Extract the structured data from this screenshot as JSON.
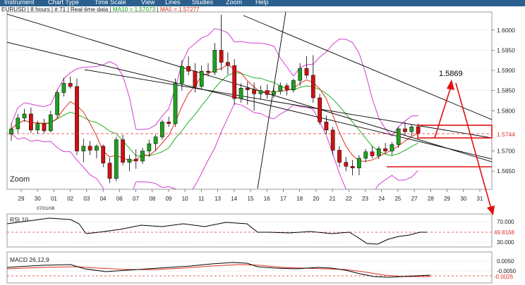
{
  "menu": [
    "Instrument",
    "Chart Type",
    "Time Scale",
    "View",
    "Lines",
    "Studies",
    "Zoom",
    "Help"
  ],
  "header": {
    "symbol": "EURUSD",
    "interval": "8 hours",
    "bars": "# 71",
    "feed": "Real-time data",
    "ma_label": "MA10 = 1.57073",
    "ma2_label": "MA5 = 1.57277"
  },
  "zoom_label": "Zoom",
  "annotation_value": "1.5869",
  "price_axis": {
    "ticks": [
      "1.6000",
      "1.5950",
      "1.5900",
      "1.5850",
      "1.5800",
      "1.5700",
      "1.5650"
    ],
    "current": "1.5744"
  },
  "date_axis": {
    "labels": [
      "29",
      "30",
      "01",
      "02",
      "03",
      "04",
      "06",
      "07",
      "08",
      "09",
      "10",
      "11",
      "13",
      "14",
      "15",
      "16",
      "17",
      "18",
      "20",
      "21",
      "22",
      "23",
      "24",
      "25",
      "27",
      "28",
      "29",
      "30",
      "31"
    ],
    "month_label": "07/01/08"
  },
  "rsi": {
    "label": "RSI 10",
    "ticks": [
      "70.000",
      "30.000"
    ],
    "current": "49.8168"
  },
  "macd": {
    "label": "MACD 26,12,9",
    "ticks": [
      "0.0050",
      "-0.0050"
    ],
    "current": "-0.0026"
  },
  "colors": {
    "menubar": "#2a5f8e",
    "bull": "#1fa01f",
    "bear": "#d01010",
    "bollinger": "#d040d0",
    "ma_green": "#20b020",
    "ma_red": "#e03020",
    "annotation": "#e01010",
    "price_marker": "#e03030"
  },
  "chart_data": {
    "type": "candlestick",
    "title": "EURUSD",
    "y_range": [
      1.5605,
      1.6045
    ],
    "candles": [
      {
        "o": 1.5742,
        "h": 1.5768,
        "l": 1.5725,
        "c": 1.5755
      },
      {
        "o": 1.5755,
        "h": 1.5792,
        "l": 1.5745,
        "c": 1.5782
      },
      {
        "o": 1.5782,
        "h": 1.5805,
        "l": 1.5772,
        "c": 1.5792
      },
      {
        "o": 1.5792,
        "h": 1.5808,
        "l": 1.5745,
        "c": 1.5752
      },
      {
        "o": 1.5752,
        "h": 1.5775,
        "l": 1.5742,
        "c": 1.5768
      },
      {
        "o": 1.5768,
        "h": 1.578,
        "l": 1.5744,
        "c": 1.575
      },
      {
        "o": 1.575,
        "h": 1.58,
        "l": 1.5746,
        "c": 1.579
      },
      {
        "o": 1.579,
        "h": 1.5852,
        "l": 1.5782,
        "c": 1.5845
      },
      {
        "o": 1.5845,
        "h": 1.5882,
        "l": 1.5835,
        "c": 1.5868
      },
      {
        "o": 1.5868,
        "h": 1.5885,
        "l": 1.5855,
        "c": 1.586
      },
      {
        "o": 1.586,
        "h": 1.588,
        "l": 1.569,
        "c": 1.57
      },
      {
        "o": 1.57,
        "h": 1.573,
        "l": 1.5672,
        "c": 1.5712
      },
      {
        "o": 1.5712,
        "h": 1.5725,
        "l": 1.569,
        "c": 1.5702
      },
      {
        "o": 1.5702,
        "h": 1.5716,
        "l": 1.5682,
        "c": 1.5712
      },
      {
        "o": 1.5712,
        "h": 1.5716,
        "l": 1.566,
        "c": 1.567
      },
      {
        "o": 1.567,
        "h": 1.5684,
        "l": 1.562,
        "c": 1.5632
      },
      {
        "o": 1.5632,
        "h": 1.5735,
        "l": 1.5625,
        "c": 1.5728
      },
      {
        "o": 1.5728,
        "h": 1.574,
        "l": 1.5665,
        "c": 1.5672
      },
      {
        "o": 1.5672,
        "h": 1.569,
        "l": 1.565,
        "c": 1.568
      },
      {
        "o": 1.568,
        "h": 1.5704,
        "l": 1.5656,
        "c": 1.5675
      },
      {
        "o": 1.5675,
        "h": 1.5708,
        "l": 1.5668,
        "c": 1.57
      },
      {
        "o": 1.57,
        "h": 1.5728,
        "l": 1.5685,
        "c": 1.5718
      },
      {
        "o": 1.5718,
        "h": 1.574,
        "l": 1.57,
        "c": 1.5735
      },
      {
        "o": 1.5735,
        "h": 1.5778,
        "l": 1.5728,
        "c": 1.5772
      },
      {
        "o": 1.5772,
        "h": 1.5785,
        "l": 1.576,
        "c": 1.5768
      },
      {
        "o": 1.5768,
        "h": 1.588,
        "l": 1.576,
        "c": 1.5868
      },
      {
        "o": 1.5868,
        "h": 1.5925,
        "l": 1.585,
        "c": 1.591
      },
      {
        "o": 1.591,
        "h": 1.5935,
        "l": 1.5888,
        "c": 1.5898
      },
      {
        "o": 1.5898,
        "h": 1.5918,
        "l": 1.5845,
        "c": 1.586
      },
      {
        "o": 1.586,
        "h": 1.5912,
        "l": 1.5852,
        "c": 1.5898
      },
      {
        "o": 1.5898,
        "h": 1.5918,
        "l": 1.5885,
        "c": 1.5895
      },
      {
        "o": 1.5895,
        "h": 1.5968,
        "l": 1.5888,
        "c": 1.595
      },
      {
        "o": 1.595,
        "h": 1.6038,
        "l": 1.59,
        "c": 1.592
      },
      {
        "o": 1.592,
        "h": 1.5945,
        "l": 1.589,
        "c": 1.5912
      },
      {
        "o": 1.5912,
        "h": 1.5928,
        "l": 1.5815,
        "c": 1.583
      },
      {
        "o": 1.583,
        "h": 1.5868,
        "l": 1.582,
        "c": 1.5856
      },
      {
        "o": 1.5856,
        "h": 1.5872,
        "l": 1.5815,
        "c": 1.5852
      },
      {
        "o": 1.5852,
        "h": 1.587,
        "l": 1.58,
        "c": 1.5842
      },
      {
        "o": 1.5842,
        "h": 1.5862,
        "l": 1.5828,
        "c": 1.585
      },
      {
        "o": 1.585,
        "h": 1.5865,
        "l": 1.583,
        "c": 1.584
      },
      {
        "o": 1.584,
        "h": 1.5862,
        "l": 1.5832,
        "c": 1.5848
      },
      {
        "o": 1.5848,
        "h": 1.587,
        "l": 1.584,
        "c": 1.5862
      },
      {
        "o": 1.5862,
        "h": 1.5868,
        "l": 1.5838,
        "c": 1.5852
      },
      {
        "o": 1.5852,
        "h": 1.588,
        "l": 1.5845,
        "c": 1.5875
      },
      {
        "o": 1.5875,
        "h": 1.5918,
        "l": 1.5862,
        "c": 1.5905
      },
      {
        "o": 1.5905,
        "h": 1.5935,
        "l": 1.588,
        "c": 1.5888
      },
      {
        "o": 1.5888,
        "h": 1.5938,
        "l": 1.582,
        "c": 1.5832
      },
      {
        "o": 1.5832,
        "h": 1.5842,
        "l": 1.5765,
        "c": 1.5772
      },
      {
        "o": 1.5772,
        "h": 1.5788,
        "l": 1.5742,
        "c": 1.5752
      },
      {
        "o": 1.5752,
        "h": 1.576,
        "l": 1.569,
        "c": 1.5702
      },
      {
        "o": 1.5702,
        "h": 1.5712,
        "l": 1.566,
        "c": 1.5672
      },
      {
        "o": 1.5672,
        "h": 1.5685,
        "l": 1.565,
        "c": 1.5662
      },
      {
        "o": 1.5662,
        "h": 1.5678,
        "l": 1.564,
        "c": 1.5658
      },
      {
        "o": 1.5658,
        "h": 1.569,
        "l": 1.564,
        "c": 1.5682
      },
      {
        "o": 1.5682,
        "h": 1.5705,
        "l": 1.5672,
        "c": 1.5698
      },
      {
        "o": 1.5698,
        "h": 1.5712,
        "l": 1.5682,
        "c": 1.5688
      },
      {
        "o": 1.5688,
        "h": 1.5712,
        "l": 1.568,
        "c": 1.5706
      },
      {
        "o": 1.5706,
        "h": 1.572,
        "l": 1.5692,
        "c": 1.57
      },
      {
        "o": 1.57,
        "h": 1.5722,
        "l": 1.569,
        "c": 1.5716
      },
      {
        "o": 1.5716,
        "h": 1.576,
        "l": 1.5708,
        "c": 1.5755
      },
      {
        "o": 1.5755,
        "h": 1.5772,
        "l": 1.5738,
        "c": 1.5748
      },
      {
        "o": 1.5748,
        "h": 1.5765,
        "l": 1.5738,
        "c": 1.576
      },
      {
        "o": 1.576,
        "h": 1.5768,
        "l": 1.574,
        "c": 1.5744
      }
    ]
  }
}
